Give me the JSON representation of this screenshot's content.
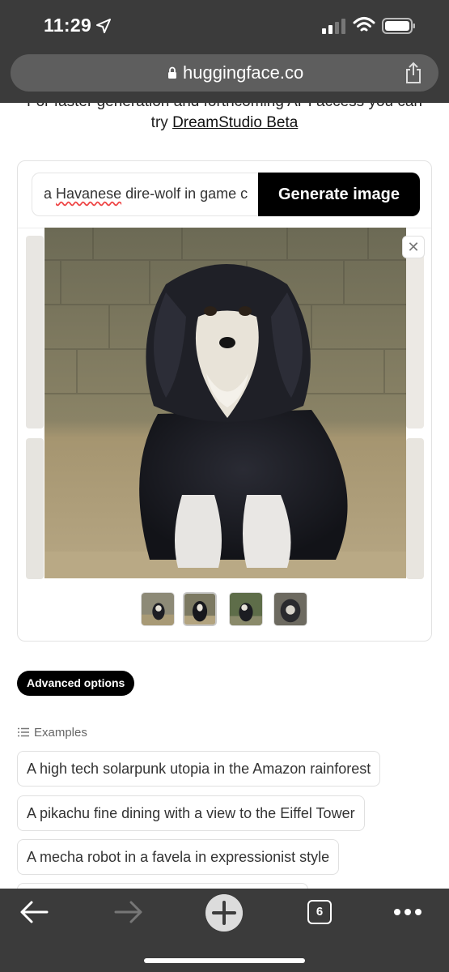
{
  "status_bar": {
    "time": "11:29"
  },
  "browser": {
    "url": "huggingface.co"
  },
  "page": {
    "cut_text": "For faster generation and forthcoming API access you can",
    "try_prefix": "try",
    "dream_link": "DreamStudio Beta"
  },
  "prompt": {
    "value_word1": "a",
    "value_misspelled": "Havanese",
    "value_rest": "dire-wolf in game c",
    "generate_label": "Generate image",
    "close_symbol": "✕"
  },
  "advanced_label": "Advanced options",
  "examples": {
    "header": "Examples",
    "items": [
      "A high tech solarpunk utopia in the Amazon rainforest",
      "A pikachu fine dining with a view to the Eiffel Tower",
      "A mecha robot in a favela in expressionist style"
    ]
  },
  "toolbar": {
    "tab_count": "6"
  },
  "colors": {
    "chrome": "#3b3b3b",
    "accent": "#000000"
  }
}
